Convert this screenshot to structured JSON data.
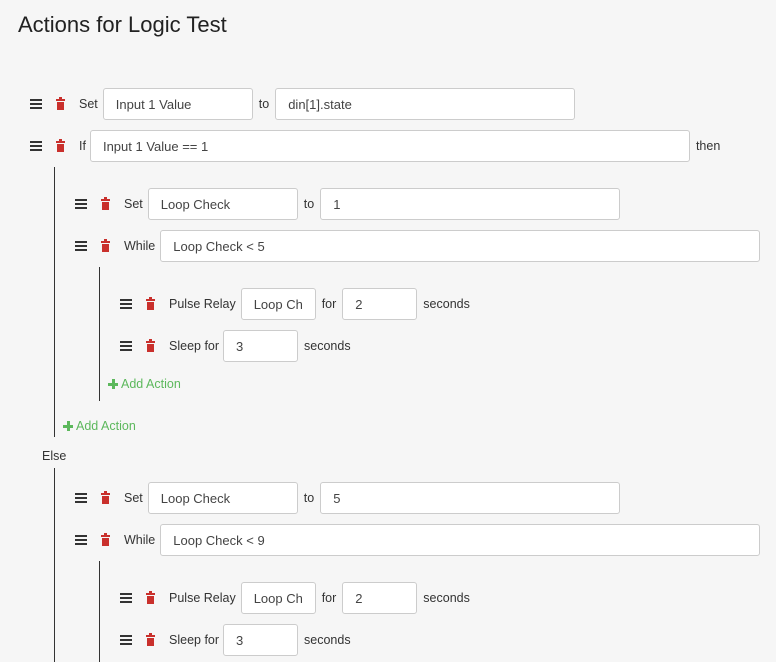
{
  "page": {
    "title": "Actions for Logic Test"
  },
  "labels": {
    "set": "Set",
    "to": "to",
    "if": "If",
    "then": "then",
    "while": "While",
    "pulse_relay": "Pulse Relay",
    "for": "for",
    "seconds": "seconds",
    "sleep_for": "Sleep for",
    "add_action": "Add Action",
    "else": "Else"
  },
  "actions": {
    "set_input": {
      "var": "Input 1 Value",
      "value": "din[1].state"
    },
    "if_cond": "Input 1 Value == 1",
    "then_set": {
      "var": "Loop Check",
      "value": "1"
    },
    "then_while": "Loop Check < 5",
    "then_pulse": {
      "relay": "Loop Check",
      "duration": "2"
    },
    "then_sleep": "3",
    "else_set": {
      "var": "Loop Check",
      "value": "5"
    },
    "else_while": "Loop Check < 9",
    "else_pulse": {
      "relay": "Loop Check",
      "duration": "2"
    },
    "else_sleep": "3"
  },
  "colors": {
    "delete": "#c9302c",
    "add": "#5cb85c",
    "guide": "#333333"
  }
}
